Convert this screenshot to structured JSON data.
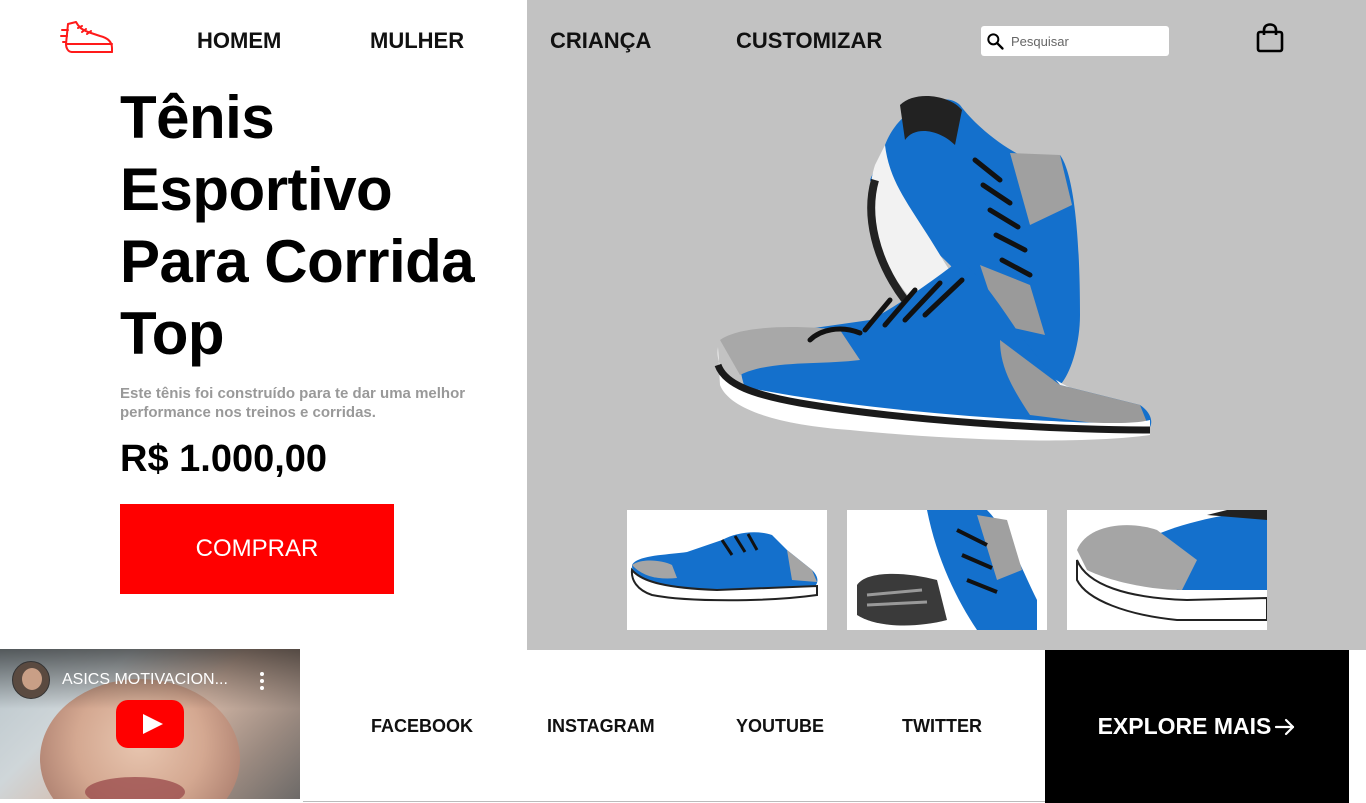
{
  "header": {
    "logo_icon": "running-shoe-icon",
    "nav": [
      {
        "label": "HOMEM"
      },
      {
        "label": "MULHER"
      },
      {
        "label": "CRIANÇA"
      },
      {
        "label": "CUSTOMIZAR"
      }
    ],
    "search": {
      "placeholder": "Pesquisar",
      "value": "",
      "icon": "search-icon"
    },
    "cart_icon": "shopping-bag-icon"
  },
  "hero": {
    "title": "Tênis Esportivo Para Corrida Top",
    "description": "Este tênis foi construído para te dar uma melhor performance nos treinos e corridas.",
    "price": "R$ 1.000,00",
    "buy_label": "COMPRAR"
  },
  "colors": {
    "accent": "#ff0000",
    "panel_bg": "#c2c2c2",
    "shoe_blue": "#1470cc",
    "explore_bg": "#000000"
  },
  "gallery": {
    "thumbnails": [
      {
        "view": "side"
      },
      {
        "view": "heel"
      },
      {
        "view": "toe-closeup"
      }
    ]
  },
  "video": {
    "title": "ASICS MOTIVACION...",
    "play_icon": "youtube-play-icon",
    "menu_icon": "more-vertical-icon"
  },
  "footer": {
    "social": [
      {
        "label": "FACEBOOK"
      },
      {
        "label": "INSTAGRAM"
      },
      {
        "label": "YOUTUBE"
      },
      {
        "label": "TWITTER"
      }
    ],
    "explore_label": "EXPLORE MAIS",
    "explore_icon": "arrow-right-icon"
  }
}
